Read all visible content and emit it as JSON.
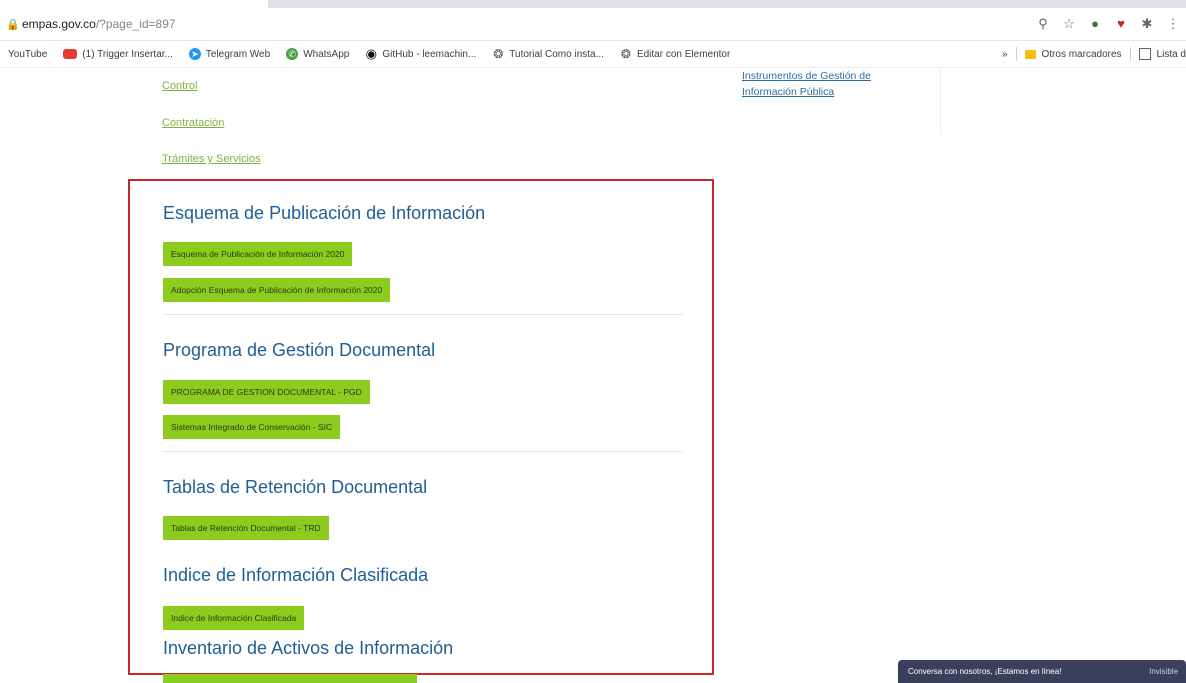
{
  "browser": {
    "url_host": "empas.gov.co",
    "url_path": "/?page_id=897",
    "toolbar_icons": [
      "zoom-icon",
      "star-icon",
      "extension-icon",
      "extension-icon",
      "puzzle-icon"
    ],
    "bookmarks": [
      {
        "label": "YouTube",
        "icon": "none"
      },
      {
        "label": "(1) Trigger Insertar...",
        "icon": "youtube-icon"
      },
      {
        "label": "Telegram Web",
        "icon": "telegram-icon"
      },
      {
        "label": "WhatsApp",
        "icon": "whatsapp-icon"
      },
      {
        "label": "GitHub - leemachin...",
        "icon": "github-icon"
      },
      {
        "label": "Tutorial Como insta...",
        "icon": "chrome-icon"
      },
      {
        "label": "Editar con Elementor",
        "icon": "chrome-icon"
      }
    ],
    "bookmarks_more": "»",
    "other_bookmarks": "Otros marcadores",
    "reading_list": "Lista d"
  },
  "page": {
    "top_links": [
      "Control",
      "Contratación",
      "Trámites y Servicios"
    ],
    "side_links": [
      "Instrumentos de Gestión de",
      "Información Pública"
    ],
    "sections": [
      {
        "title": "Esquema de Publicación de Información",
        "buttons": [
          "Esquema de Publicación de Información 2020",
          "Adopción Esquema de Publicación de Información 2020"
        ]
      },
      {
        "title": "Programa de Gestión Documental",
        "buttons": [
          "PROGRAMA DE GESTION DOCUMENTAL - PGD",
          "Sistemas Integrado de Conservación - SIC"
        ]
      },
      {
        "title": "Tablas de Retención Documental",
        "buttons": [
          "Tablas de Retención Documental - TRD"
        ]
      },
      {
        "title": "Indice de Información Clasificada",
        "buttons": [
          "Indice de Información Clasificada"
        ]
      },
      {
        "title": "Inventario de Activos de Información",
        "buttons": []
      }
    ]
  },
  "chat_widget": {
    "text": "Conversa con nosotros, ¡Estamos en línea!",
    "status": "Invisible"
  },
  "colors": {
    "accent_green": "#8ccc1e",
    "heading_blue": "#1f5e96",
    "highlight_red": "#c62828"
  }
}
